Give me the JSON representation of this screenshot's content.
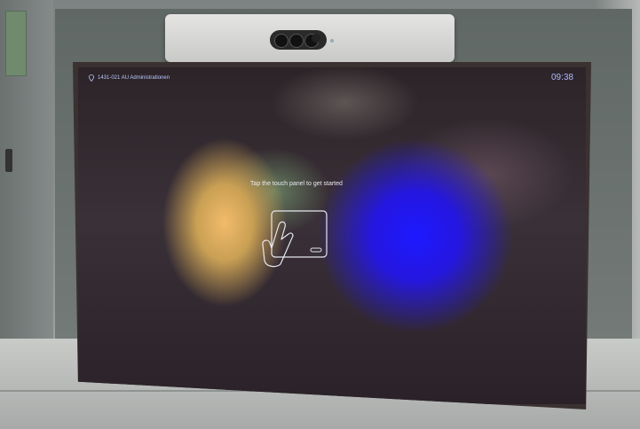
{
  "screen": {
    "room_name": "1431-021 AU Administrationen",
    "time": "09:38",
    "prompt": "Tap the touch panel to get started"
  },
  "icons": {
    "location": "location-pin-icon",
    "touch": "touch-panel-tap-icon"
  },
  "colors": {
    "blue_glow": "#1d18ff",
    "yellow_glow": "#f2bb6a",
    "text": "#e8e8ef"
  }
}
